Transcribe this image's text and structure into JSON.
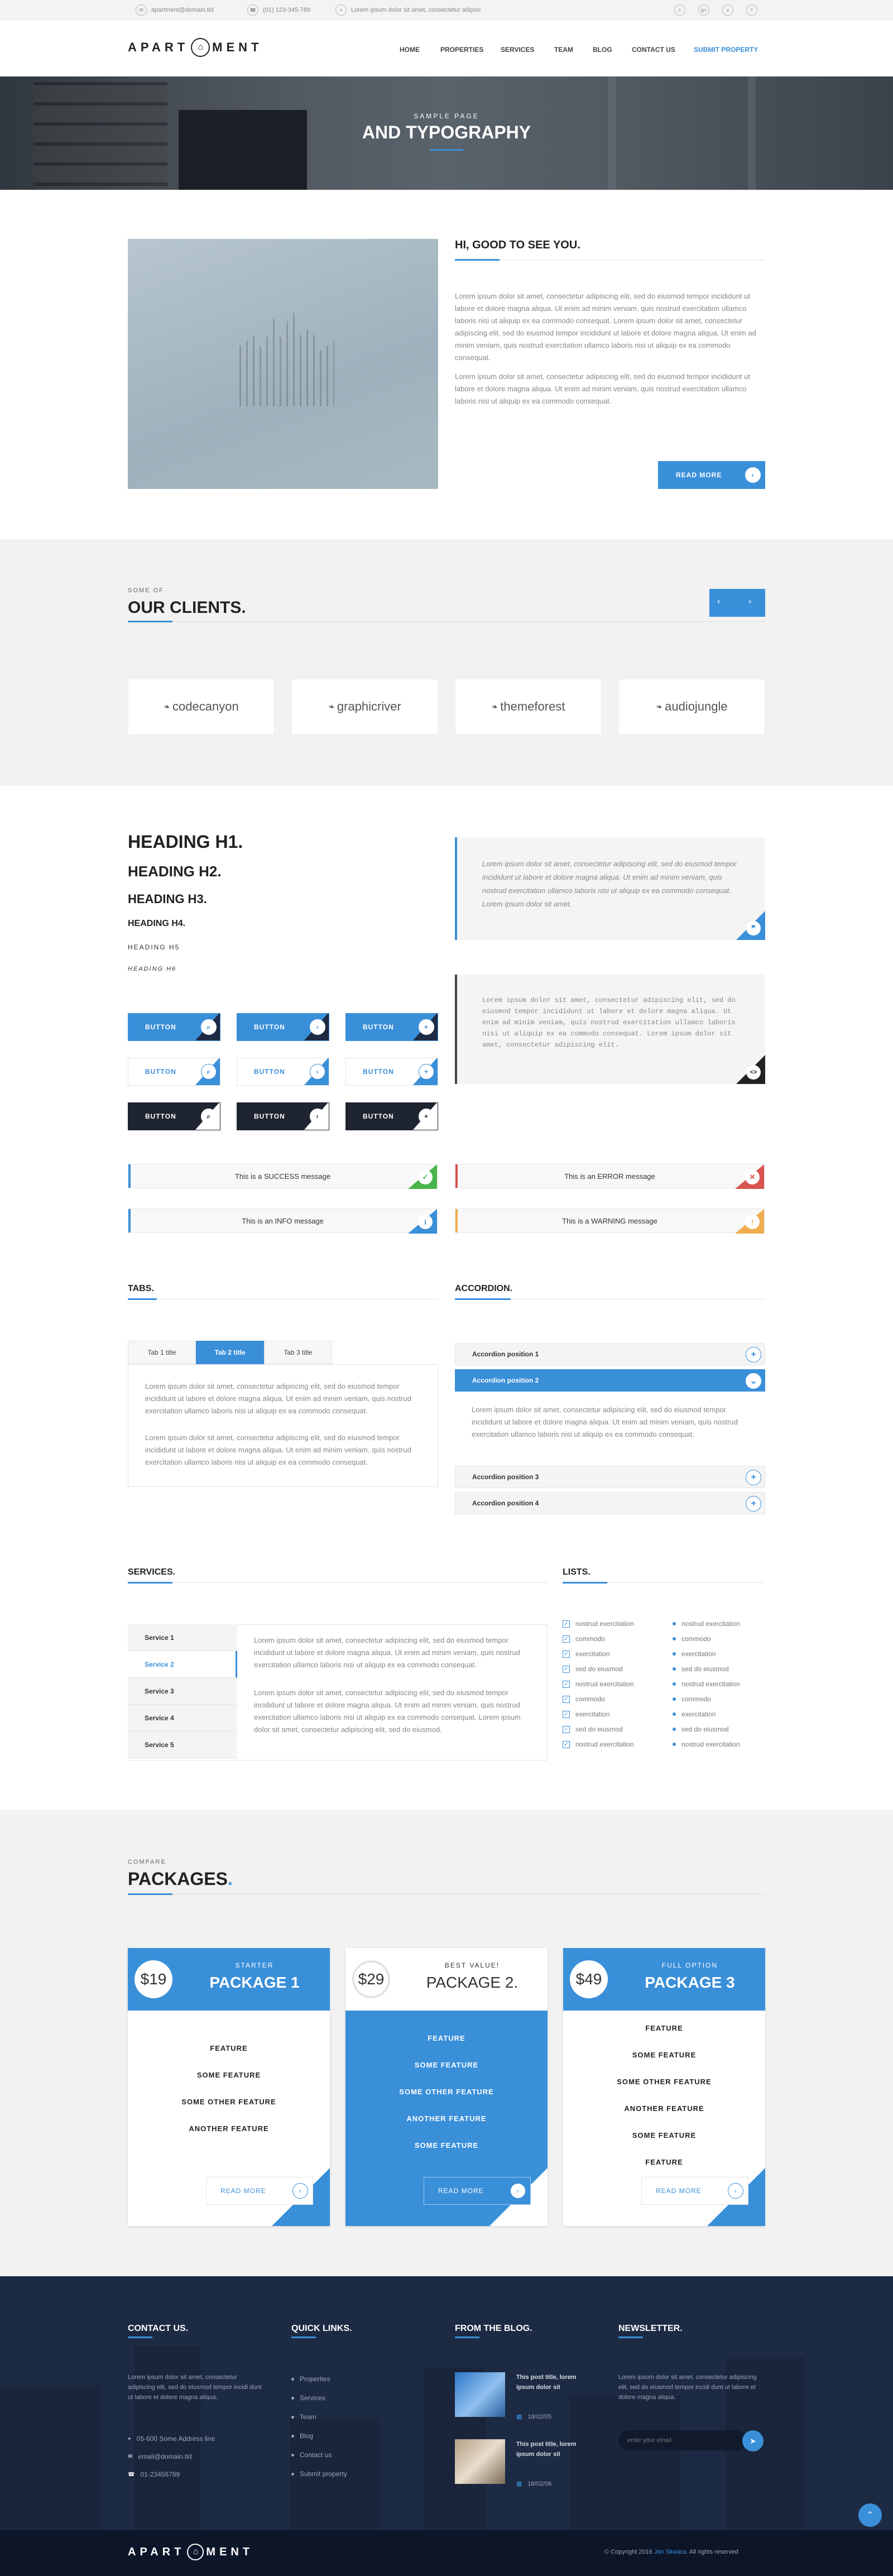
{
  "topbar": {
    "email": "apartment@domain.tld",
    "phone": "(01) 123-345-789",
    "tagline": "Lorem ipsum dolor sit amet, consectetur adipisc",
    "social_icons": [
      "twitter-icon",
      "google-plus-icon",
      "vimeo-icon",
      "facebook-icon"
    ]
  },
  "header": {
    "logo_left": "APART",
    "logo_right": "MENT",
    "nav": [
      "HOME",
      "PROPERTIES",
      "SERVICES",
      "TEAM",
      "BLOG",
      "CONTACT US",
      "SUBMIT PROPERTY"
    ]
  },
  "hero": {
    "subtitle": "SAMPLE PAGE",
    "title": "AND TYPOGRAPHY"
  },
  "intro": {
    "title": "HI, GOOD TO SEE YOU.",
    "para1": "Lorem ipsum dolor sit amet, consectetur adipiscing elit, sed do eiusmod tempor incididunt ut labore et dolore magna aliqua. Ut enim ad minim veniam, quis nostrud exercitation ullamco laboris nisi ut aliquip ex ea commodo consequat. Lorem ipsum dolor sit amet, consectetur adipiscing elit, sed do eiusmod tempor incididunt ut labore et dolore magna aliqua. Ut enim ad minim veniam, quis nostrud exercitation ullamco laboris nisi ut aliquip ex ea commodo consequat.",
    "para2": "Lorem ipsum dolor sit amet, consectetur adipiscing elit, sed do eiusmod tempor incididunt ut labore et dolore magna aliqua. Ut enim ad minim veniam, quis nostrud exercitation ullamco laboris nisi ut aliquip ex ea commodo consequat.",
    "button": "READ MORE"
  },
  "clients": {
    "kicker": "SOME OF",
    "title": "OUR CLIENTS.",
    "logos": [
      "codecanyon",
      "graphicriver",
      "themeforest",
      "audiojungle"
    ]
  },
  "typography": {
    "h1": "HEADING H1.",
    "h2": "HEADING H2.",
    "h3": "HEADING H3.",
    "h4": "HEADING H4.",
    "h5": "HEADING H5",
    "h6": "HEADING H6",
    "quote": "Lorem ipsum dolor sit amet, consectetur adipiscing elit, sed do eiusmod tempor incididunt ut labore et dolore magna aliqua. Ut enim ad minim veniam, quis nostrud exercitation ullamco laboris nisi ut aliquip ex ea commodo consequat. Lorem ipsum dolor sit amet.",
    "code": "Lorem ipsum dolor sit amet, consectetur adipiscing elit, sed do eiusmod tempor incididunt ut labore et dolore magna aliqua. Ut enim ad minim veniam, quis nostrud exercitation ullamco laboris nisi ut aliquip ex ea commodo consequat. Lorem ipsum dolor sit amet, consectetur adipiscing elit.",
    "button_label": "BUTTON"
  },
  "messages": {
    "success": "This is a SUCCESS message",
    "error": "This is an ERROR message",
    "info": "This is an INFO message",
    "warning": "This is a WARNING message"
  },
  "tabs": {
    "title": "TABS.",
    "labels": [
      "Tab 1 title",
      "Tab 2 title",
      "Tab 3 title"
    ],
    "para1": "Lorem ipsum dolor sit amet, consectetur adipiscing elit, sed do eiusmod tempor incididunt ut labore et dolore magna aliqua. Ut enim ad minim veniam, quis nostrud exercitation ullamco laboris nisi ut aliquip ex ea commodo consequat.",
    "para2": "Lorem ipsum dolor sit amet, consectetur adipiscing elit, sed do eiusmod tempor incididunt ut labore et dolore magna aliqua. Ut enim ad minim veniam, quis nostrud exercitation ullamco laboris nisi ut aliquip ex ea commodo consequat."
  },
  "accordion": {
    "title": "ACCORDION.",
    "items": [
      "Accordion position 1",
      "Accordion position 2",
      "Accordion position 3",
      "Accordion position 4"
    ],
    "content": "Lorem ipsum dolor sit amet, consectetur adipiscing elit, sed do eiusmod tempor incididunt ut labore et dolore magna aliqua. Ut enim ad minim veniam, quis nostrud exercitation ullamco laboris nisi ut aliquip ex ea commodo consequat."
  },
  "services": {
    "title": "SERVICES.",
    "items": [
      "Service 1",
      "Service 2",
      "Service 3",
      "Service 4",
      "Service 5"
    ],
    "para1": "Lorem ipsum dolor sit amet, consectetur adipiscing elit, sed do eiusmod tempor incididunt ut labore et dolore magna aliqua. Ut enim ad minim veniam, quis nostrud exercitation ullamco laboris nisi ut aliquip ex ea commodo consequat.",
    "para2": "Lorem ipsum dolor sit amet, consectetur adipiscing elit, sed do eiusmod tempor incididunt ut labore et dolore magna aliqua. Ut enim ad minim veniam, quis nostrud exercitation ullamco laboris nisi ut aliquip ex ea commodo consequat. Lorem ipsum dolor sit amet, consectetur adipiscing elit, sed do eiusmod."
  },
  "lists": {
    "title": "LISTS.",
    "col1": [
      "nostrud exercitation",
      "commodo",
      "exercitation",
      "sed do eiusmod",
      "nostrud exercitation",
      "commodo",
      "exercitation",
      "sed do eiusmod",
      "nostrud exercitation"
    ],
    "col2": [
      "nostrud exercitation",
      "commodo",
      "exercitation",
      "sed do eiusmod",
      "nostrud exercitation",
      "commodo",
      "exercitation",
      "sed do eiusmod",
      "nostrud exercitation"
    ]
  },
  "packages": {
    "kicker": "COMPARE",
    "title": "PACKAGES",
    "items": [
      {
        "price": "$19",
        "tag": "STARTER",
        "name": "PACKAGE 1",
        "features": [
          "FEATURE",
          "SOME FEATURE",
          "SOME OTHER FEATURE",
          "ANOTHER FEATURE"
        ],
        "button": "READ MORE"
      },
      {
        "price": "$29",
        "tag": "BEST VALUE!",
        "name": "PACKAGE 2.",
        "features": [
          "FEATURE",
          "SOME FEATURE",
          "SOME OTHER FEATURE",
          "ANOTHER FEATURE",
          "SOME FEATURE"
        ],
        "button": "READ MORE"
      },
      {
        "price": "$49",
        "tag": "FULL OPTION",
        "name": "PACKAGE 3",
        "features": [
          "FEATURE",
          "SOME FEATURE",
          "SOME OTHER FEATURE",
          "ANOTHER FEATURE",
          "SOME FEATURE",
          "FEATURE"
        ],
        "button": "READ MORE"
      }
    ]
  },
  "footer": {
    "contact_title": "CONTACT US.",
    "contact_text": "Lorem ipsum dolor sit amet, consectetur adipiscing elit, sed do eiusmod tempor incidi dunt ut labore et dolore magna aliqua.",
    "address": "05-600 Some Address line",
    "email": "email@domain.tld",
    "phone": "01-23456789",
    "links_title": "QUICK LINKS.",
    "links": [
      "Properties",
      "Services",
      "Team",
      "Blog",
      "Contact us",
      "Submit property"
    ],
    "blog_title": "FROM THE BLOG.",
    "posts": [
      {
        "title": "This post title, lorem ipsum dolor sit",
        "date": "18/02/05"
      },
      {
        "title": "This post title, lorem ipsum dolor sit",
        "date": "18/02/06"
      }
    ],
    "newsletter_title": "NEWSLETTER.",
    "newsletter_text": "Lorem ipsum dolor sit amet, consectetur adipiscing elit, sed do eiusmod tempor incidi dunt ut labore et dolore magna aliqua.",
    "newsletter_placeholder": "enter your email",
    "copyright_prefix": "Copyright 2016 ",
    "copyright_author": "Jan Skwara",
    "copyright_suffix": ". All rights reserved"
  },
  "colors": {
    "accent": "#3a8fd9",
    "dark": "#1d2a44",
    "success": "#47b54a",
    "error": "#d9534f",
    "warning": "#f0ad4e"
  }
}
